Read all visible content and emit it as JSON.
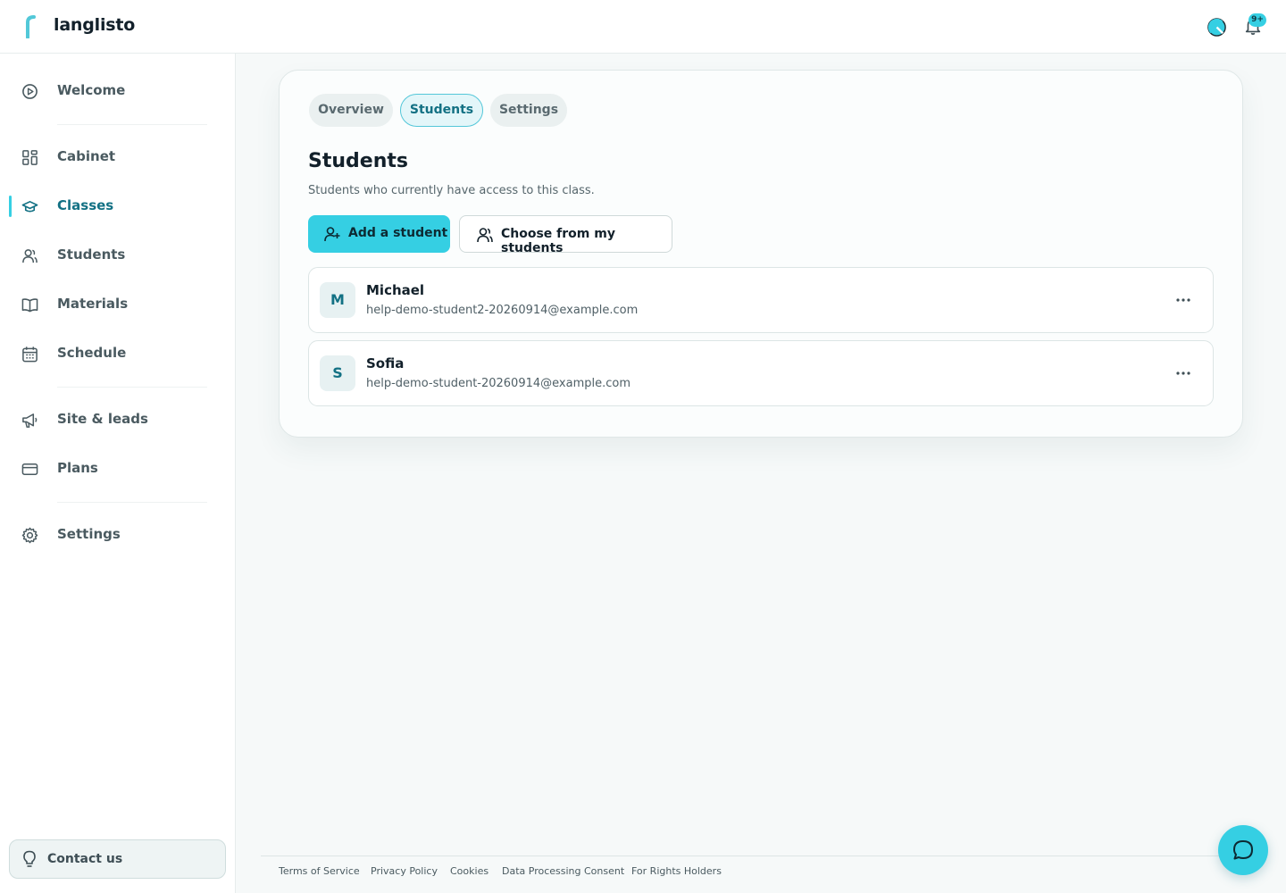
{
  "header": {
    "brand": "langlisto",
    "notification_badge": "9+"
  },
  "sidebar": {
    "items": [
      {
        "label": "Welcome",
        "icon": "play-circle-icon"
      },
      {
        "label": "Cabinet",
        "icon": "grid-icon"
      },
      {
        "label": "Classes",
        "icon": "graduation-cap-icon",
        "active": true
      },
      {
        "label": "Students",
        "icon": "users-icon"
      },
      {
        "label": "Materials",
        "icon": "book-icon"
      },
      {
        "label": "Schedule",
        "icon": "calendar-icon"
      },
      {
        "label": "Site & leads",
        "icon": "megaphone-icon"
      },
      {
        "label": "Plans",
        "icon": "credit-card-icon"
      },
      {
        "label": "Settings",
        "icon": "gear-icon"
      }
    ],
    "contact_label": "Contact us"
  },
  "tabs": {
    "overview": "Overview",
    "students": "Students",
    "settings": "Settings",
    "active": "Students"
  },
  "main": {
    "title": "Students",
    "subtitle": "Students who currently have access to this class.",
    "add_student_label": "Add a student",
    "choose_label": "Choose from my students"
  },
  "students": [
    {
      "initial": "M",
      "name": "Michael",
      "email": "help-demo-student2-20260914@example.com"
    },
    {
      "initial": "S",
      "name": "Sofia",
      "email": "help-demo-student-20260914@example.com"
    }
  ],
  "footer": {
    "terms": "Terms of Service",
    "privacy": "Privacy Policy",
    "cookies": "Cookies",
    "consent": "Data Processing Consent",
    "rights": "For Rights Holders"
  },
  "colors": {
    "accent": "#35cfe3",
    "active_text": "#137184",
    "background": "#f6f9f9"
  }
}
